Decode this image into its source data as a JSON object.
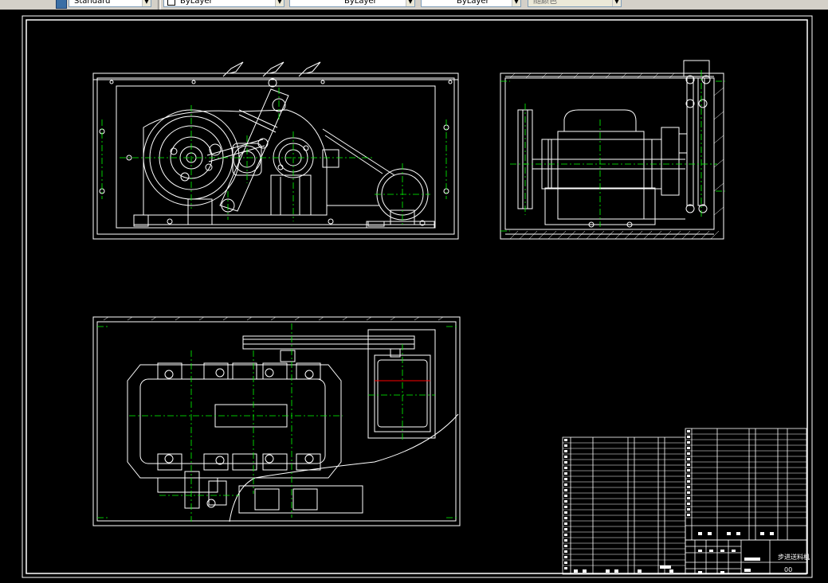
{
  "toolbar": {
    "text_style": "Standard",
    "layer_color": "ByLayer",
    "linetype": "ByLayer",
    "lineweight": "ByLayer",
    "plot_style": "随颜色"
  },
  "title_block": {
    "drawing_name": "步进送料机",
    "drawing_number": "00"
  },
  "colors": {
    "background": "#000000",
    "line": "#ffffff",
    "center_line": "#00ff00",
    "cutting_line": "#ff0000"
  }
}
